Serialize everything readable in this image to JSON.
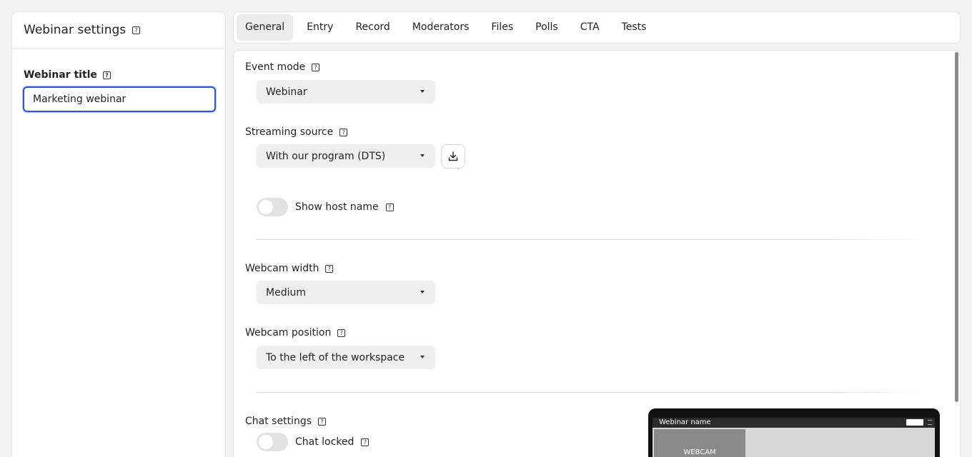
{
  "sidebar": {
    "title": "Webinar settings",
    "field_label": "Webinar title",
    "title_value": "Marketing webinar"
  },
  "tabs": [
    {
      "label": "General",
      "active": true
    },
    {
      "label": "Entry"
    },
    {
      "label": "Record"
    },
    {
      "label": "Moderators"
    },
    {
      "label": "Files"
    },
    {
      "label": "Polls"
    },
    {
      "label": "CTA"
    },
    {
      "label": "Tests"
    }
  ],
  "general": {
    "event_mode": {
      "label": "Event mode",
      "value": "Webinar"
    },
    "streaming_source": {
      "label": "Streaming source",
      "value": "With our program (DTS)"
    },
    "show_host_name": {
      "label": "Show host name",
      "enabled": false
    },
    "webcam_width": {
      "label": "Webcam width",
      "value": "Medium"
    },
    "webcam_position": {
      "label": "Webcam position",
      "value": "To the left of the workspace"
    },
    "chat_settings": {
      "label": "Chat settings"
    },
    "chat_locked": {
      "label": "Chat locked",
      "enabled": false
    }
  },
  "preview": {
    "webinar_name": "Webinar name",
    "webcam_label": "WEBCAM"
  },
  "help_glyph": "?",
  "icons": {
    "help": "help-icon",
    "caret": "caret-down-icon",
    "download": "download-icon"
  },
  "colors": {
    "focus_ring": "#2a57d6",
    "active_tab": "#ececec",
    "select_bg": "#efefef"
  }
}
